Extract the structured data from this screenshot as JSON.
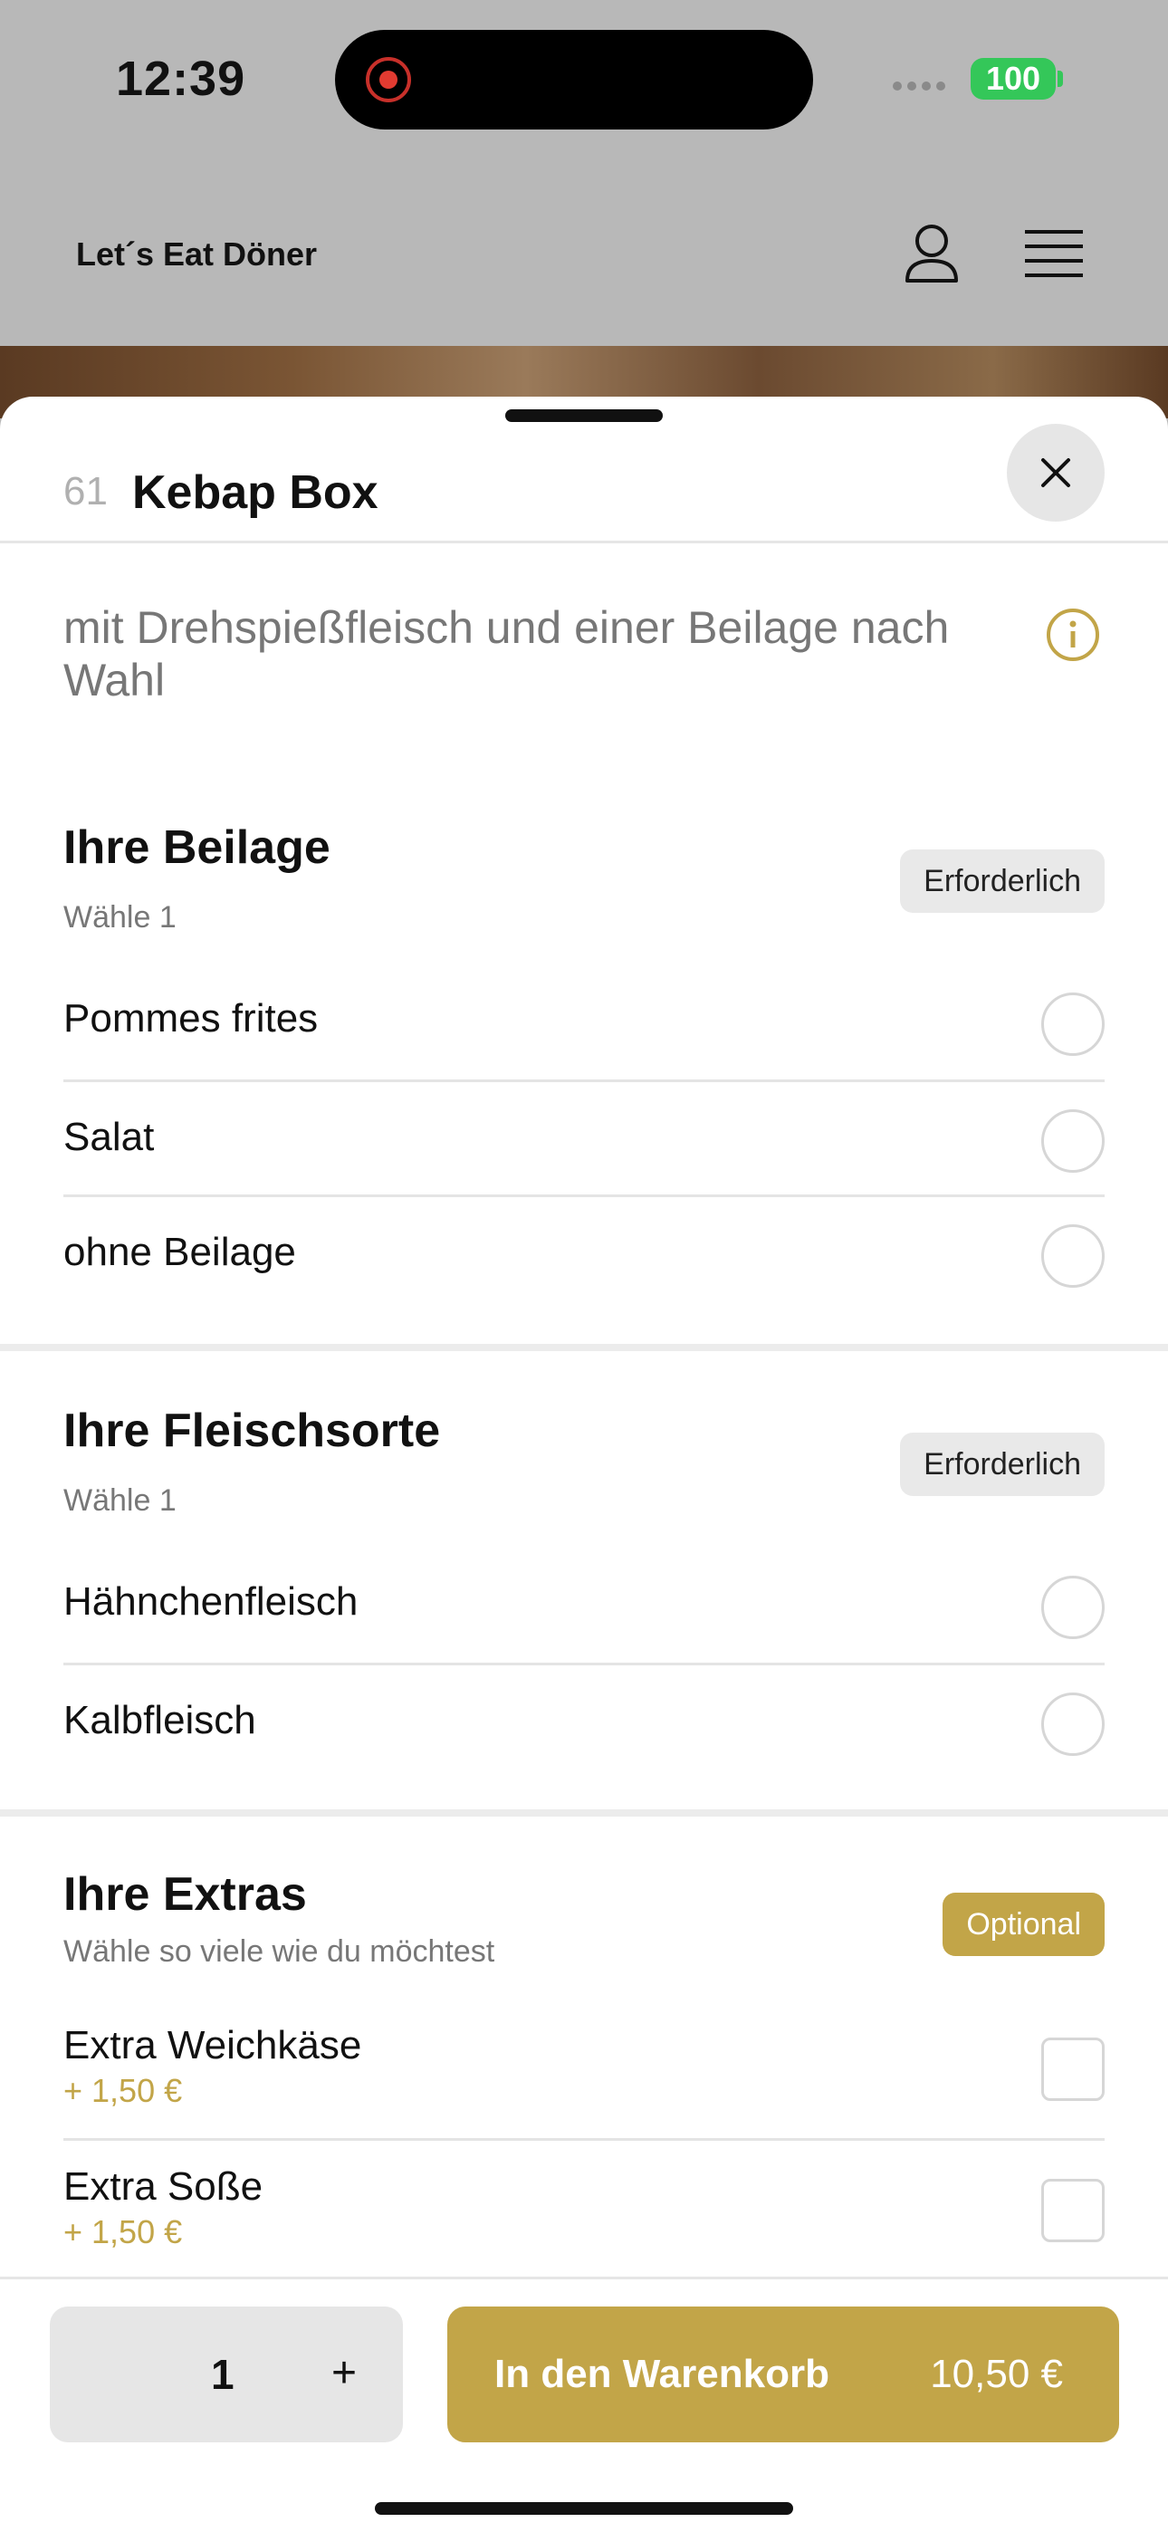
{
  "status_bar": {
    "time": "12:39",
    "battery": "100"
  },
  "header": {
    "brand": "Let´s Eat Döner"
  },
  "item": {
    "number": "61",
    "title": "Kebap Box",
    "description": "mit Drehspießfleisch und einer Beilage nach Wahl"
  },
  "sections": [
    {
      "title": "Ihre Beilage",
      "subtitle": "Wähle 1",
      "badge": "Erforderlich",
      "options": [
        "Pommes frites",
        "Salat",
        "ohne Beilage"
      ]
    },
    {
      "title": "Ihre Fleischsorte",
      "subtitle": "Wähle 1",
      "badge": "Erforderlich",
      "options": [
        "Hähnchenfleisch",
        "Kalbfleisch"
      ]
    },
    {
      "title": "Ihre Extras",
      "subtitle": "Wähle so viele wie du möchtest",
      "badge": "Optional",
      "options": [
        {
          "label": "Extra Weichkäse",
          "price": "+ 1,50 €"
        },
        {
          "label": "Extra Soße",
          "price": "+ 1,50 €"
        }
      ]
    }
  ],
  "footer": {
    "quantity": "1",
    "plus": "+",
    "cart_label": "In den Warenkorb",
    "cart_price": "10,50 €"
  },
  "colors": {
    "accent": "#c2a548",
    "battery": "#34c759",
    "record": "#e23b31"
  }
}
